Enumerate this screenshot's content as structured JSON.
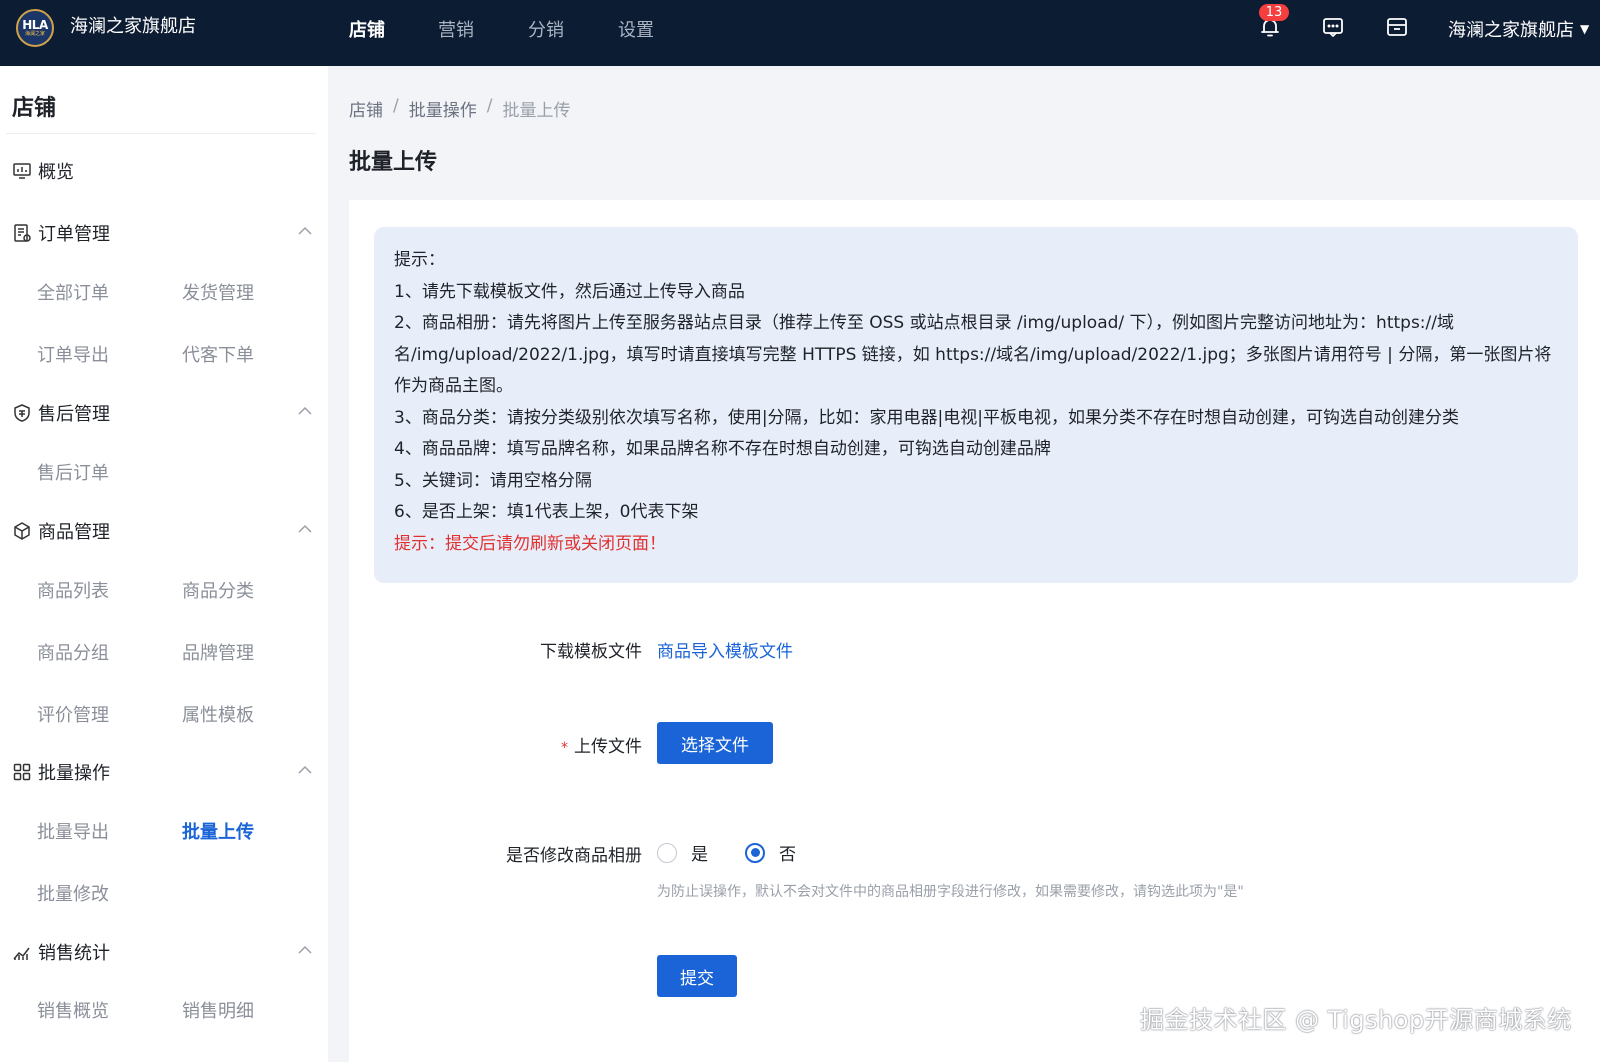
{
  "header": {
    "logo_text": "HLA",
    "logo_subtext": "海澜之家",
    "shop_name": "海澜之家旗舰店",
    "nav": [
      "店铺",
      "营销",
      "分销",
      "设置"
    ],
    "active_nav": "店铺",
    "notification_count": "13",
    "user_name": "海澜之家旗舰店"
  },
  "sidebar": {
    "title": "店铺",
    "overview": "概览",
    "groups": [
      {
        "label": "订单管理",
        "icon": "order-icon",
        "items": [
          "全部订单",
          "发货管理",
          "订单导出",
          "代客下单"
        ]
      },
      {
        "label": "售后管理",
        "icon": "aftersale-icon",
        "items": [
          "售后订单"
        ]
      },
      {
        "label": "商品管理",
        "icon": "product-box-icon",
        "items": [
          "商品列表",
          "商品分类",
          "商品分组",
          "品牌管理",
          "评价管理",
          "属性模板"
        ]
      },
      {
        "label": "批量操作",
        "icon": "batch-grid-icon",
        "items": [
          "批量导出",
          "批量上传",
          "批量修改"
        ]
      },
      {
        "label": "销售统计",
        "icon": "sales-chart-icon",
        "items": [
          "销售概览",
          "销售明细"
        ]
      }
    ],
    "active_item": "批量上传"
  },
  "breadcrumb": [
    "店铺",
    "批量操作",
    "批量上传"
  ],
  "page_title": "批量上传",
  "tips": {
    "lines": [
      "提示：",
      "1、请先下载模板文件，然后通过上传导入商品",
      "2、商品相册：请先将图片上传至服务器站点目录（推荐上传至 OSS 或站点根目录 /img/upload/ 下），例如图片完整访问地址为：https://域名/img/upload/2022/1.jpg，填写时请直接填写完整 HTTPS 链接，如 https://域名/img/upload/2022/1.jpg；多张图片请用符号 | 分隔，第一张图片将作为商品主图。",
      "3、商品分类：请按分类级别依次填写名称，使用|分隔，比如：家用电器|电视|平板电视，如果分类不存在时想自动创建，可钩选自动创建分类",
      "4、商品品牌：填写品牌名称，如果品牌名称不存在时想自动创建，可钩选自动创建品牌",
      "5、关键词：请用空格分隔",
      "6、是否上架：填1代表上架，0代表下架"
    ],
    "warning": "提示：提交后请勿刷新或关闭页面！"
  },
  "form": {
    "download_label": "下载模板文件",
    "download_link": "商品导入模板文件",
    "upload_required_mark": "*",
    "upload_label": "上传文件",
    "choose_file_button": "选择文件",
    "album_label": "是否修改商品相册",
    "option_yes": "是",
    "option_no": "否",
    "selected_option": "否",
    "album_hint": "为防止误操作，默认不会对文件中的商品相册字段进行修改，如果需要修改，请钩选此项为\"是\"",
    "submit_button": "提交"
  },
  "watermark": "掘金技术社区 @ Tigshop开源商城系统"
}
